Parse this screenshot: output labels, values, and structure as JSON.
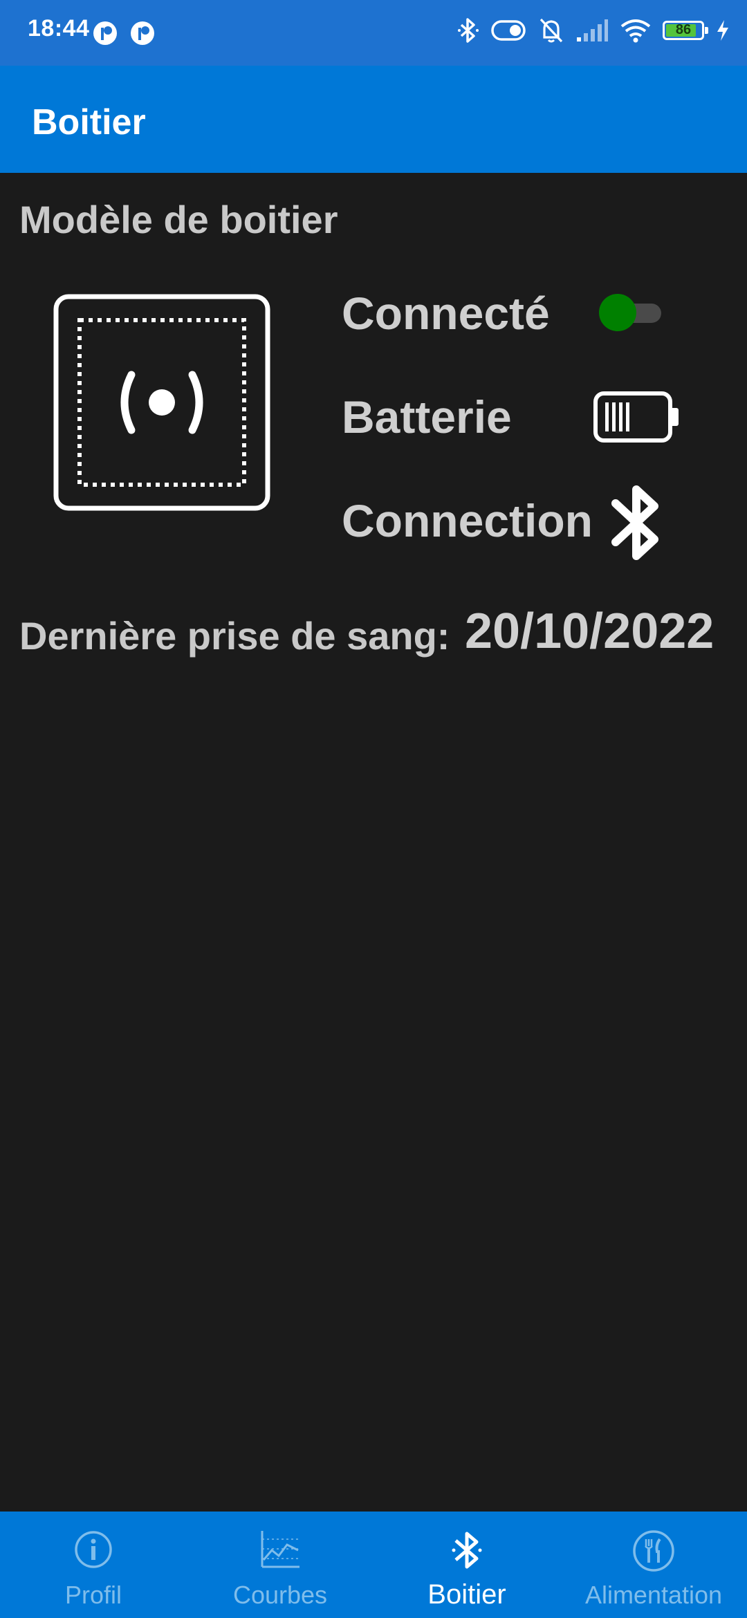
{
  "status_bar": {
    "time": "18:44",
    "battery_level": "86",
    "icons": [
      "app-notification-icon",
      "app-notification-icon",
      "bluetooth-icon",
      "toggle-icon",
      "bell-off-icon",
      "signal-icon",
      "wifi-icon",
      "battery-icon",
      "charging-bolt-icon"
    ]
  },
  "app_bar": {
    "title": "Boitier"
  },
  "main": {
    "section_title": "Modèle de boitier",
    "device_icon": "signal-box-icon",
    "rows": [
      {
        "label": "Connecté",
        "indicator": "toggle",
        "value": true
      },
      {
        "label": "Batterie",
        "indicator": "battery-icon"
      },
      {
        "label": "Connection",
        "indicator": "bluetooth-icon"
      }
    ],
    "last_sample_label": "Dernière prise de sang:",
    "last_sample_value": "20/10/2022"
  },
  "bottom_nav": {
    "items": [
      {
        "label": "Profil",
        "icon": "info-icon",
        "active": false
      },
      {
        "label": "Courbes",
        "icon": "chart-icon",
        "active": false
      },
      {
        "label": "Boitier",
        "icon": "bluetooth-icon",
        "active": true
      },
      {
        "label": "Alimentation",
        "icon": "restaurant-icon",
        "active": false
      }
    ]
  },
  "colors": {
    "status_bar": "#1e72d0",
    "app_bar": "#0078d7",
    "background": "#1b1b1b",
    "toggle_on": "#008000",
    "nav_inactive": "#7fbdeb"
  }
}
